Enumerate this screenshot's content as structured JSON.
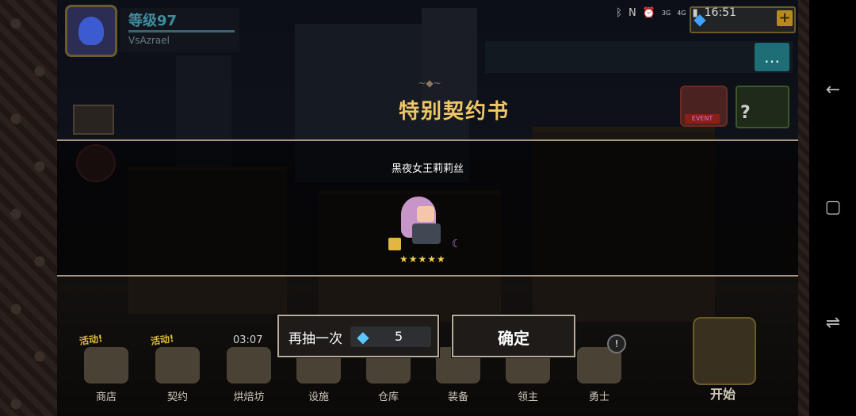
{
  "player": {
    "level_label": "等级97",
    "name": "VsAzrael"
  },
  "status_bar": {
    "icons": [
      "bluetooth-icon",
      "nfc-icon",
      "alarm-icon",
      "3g-signal-icon",
      "4g-signal-icon",
      "battery-icon"
    ],
    "network_3g": "3G",
    "network_4g": "4G",
    "time": "16:51"
  },
  "currency": {
    "plus_label": "+"
  },
  "dialog": {
    "title": "特别契约书",
    "ornament": "~◆~",
    "hero_name": "黑夜女王莉莉丝",
    "stars": "★★★★★",
    "rarity": 5
  },
  "buttons": {
    "redraw_label": "再抽一次",
    "redraw_cost": "5",
    "confirm_label": "确定"
  },
  "bottom_nav": {
    "items": [
      {
        "label": "商店",
        "badge": "活动!"
      },
      {
        "label": "契约",
        "badge": "活动!"
      },
      {
        "label": "烘焙坊",
        "timer": "03:07"
      },
      {
        "label": "设施"
      },
      {
        "label": "仓库"
      },
      {
        "label": "装备"
      },
      {
        "label": "领主"
      },
      {
        "label": "勇士",
        "alert": "!"
      }
    ],
    "start_label": "开始"
  },
  "hud": {
    "event_label": "EVENT",
    "help_glyph": "?"
  },
  "colors": {
    "title_gold": "#f0c766",
    "panel_border": "#a7977e",
    "gem_blue": "#5cc8ff"
  }
}
